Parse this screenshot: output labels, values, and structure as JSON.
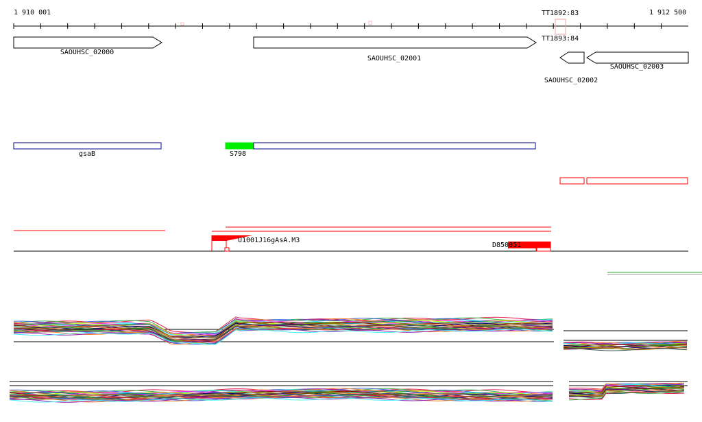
{
  "ruler": {
    "start_label": "1 910 001",
    "end_label": "1 912 500",
    "terminator_top": "TT1892:83",
    "terminator_bottom": "TT1893:84"
  },
  "genes": [
    {
      "id": "SAOUHSC_02000",
      "strand": "+"
    },
    {
      "id": "SAOUHSC_02001",
      "strand": "+"
    },
    {
      "id": "SAOUHSC_02002",
      "strand": "-"
    },
    {
      "id": "SAOUHSC_02003",
      "strand": "-"
    }
  ],
  "features": {
    "gsab": "gsaB",
    "s798": "S798"
  },
  "annotations": {
    "overlap_label": "U1001J16gAsA.M3",
    "d_label": "D850051"
  },
  "colors": {
    "feature_outline_blue": "#00008b",
    "feature_fill_green": "#00ee00",
    "feature_outline_red": "#ff0000",
    "terminator_box": "#f4a3a3",
    "green_line": "#2eaa2e"
  }
}
